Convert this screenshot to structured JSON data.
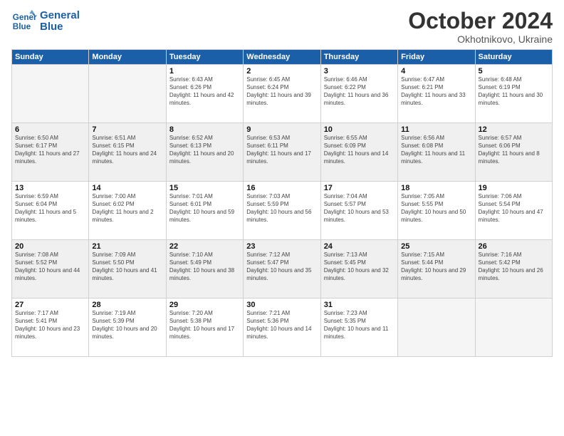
{
  "header": {
    "logo_line1": "General",
    "logo_line2": "Blue",
    "month": "October 2024",
    "location": "Okhotnikovo, Ukraine"
  },
  "weekdays": [
    "Sunday",
    "Monday",
    "Tuesday",
    "Wednesday",
    "Thursday",
    "Friday",
    "Saturday"
  ],
  "weeks": [
    [
      {
        "day": "",
        "info": ""
      },
      {
        "day": "",
        "info": ""
      },
      {
        "day": "1",
        "info": "Sunrise: 6:43 AM\nSunset: 6:26 PM\nDaylight: 11 hours and 42 minutes."
      },
      {
        "day": "2",
        "info": "Sunrise: 6:45 AM\nSunset: 6:24 PM\nDaylight: 11 hours and 39 minutes."
      },
      {
        "day": "3",
        "info": "Sunrise: 6:46 AM\nSunset: 6:22 PM\nDaylight: 11 hours and 36 minutes."
      },
      {
        "day": "4",
        "info": "Sunrise: 6:47 AM\nSunset: 6:21 PM\nDaylight: 11 hours and 33 minutes."
      },
      {
        "day": "5",
        "info": "Sunrise: 6:48 AM\nSunset: 6:19 PM\nDaylight: 11 hours and 30 minutes."
      }
    ],
    [
      {
        "day": "6",
        "info": "Sunrise: 6:50 AM\nSunset: 6:17 PM\nDaylight: 11 hours and 27 minutes."
      },
      {
        "day": "7",
        "info": "Sunrise: 6:51 AM\nSunset: 6:15 PM\nDaylight: 11 hours and 24 minutes."
      },
      {
        "day": "8",
        "info": "Sunrise: 6:52 AM\nSunset: 6:13 PM\nDaylight: 11 hours and 20 minutes."
      },
      {
        "day": "9",
        "info": "Sunrise: 6:53 AM\nSunset: 6:11 PM\nDaylight: 11 hours and 17 minutes."
      },
      {
        "day": "10",
        "info": "Sunrise: 6:55 AM\nSunset: 6:09 PM\nDaylight: 11 hours and 14 minutes."
      },
      {
        "day": "11",
        "info": "Sunrise: 6:56 AM\nSunset: 6:08 PM\nDaylight: 11 hours and 11 minutes."
      },
      {
        "day": "12",
        "info": "Sunrise: 6:57 AM\nSunset: 6:06 PM\nDaylight: 11 hours and 8 minutes."
      }
    ],
    [
      {
        "day": "13",
        "info": "Sunrise: 6:59 AM\nSunset: 6:04 PM\nDaylight: 11 hours and 5 minutes."
      },
      {
        "day": "14",
        "info": "Sunrise: 7:00 AM\nSunset: 6:02 PM\nDaylight: 11 hours and 2 minutes."
      },
      {
        "day": "15",
        "info": "Sunrise: 7:01 AM\nSunset: 6:01 PM\nDaylight: 10 hours and 59 minutes."
      },
      {
        "day": "16",
        "info": "Sunrise: 7:03 AM\nSunset: 5:59 PM\nDaylight: 10 hours and 56 minutes."
      },
      {
        "day": "17",
        "info": "Sunrise: 7:04 AM\nSunset: 5:57 PM\nDaylight: 10 hours and 53 minutes."
      },
      {
        "day": "18",
        "info": "Sunrise: 7:05 AM\nSunset: 5:55 PM\nDaylight: 10 hours and 50 minutes."
      },
      {
        "day": "19",
        "info": "Sunrise: 7:06 AM\nSunset: 5:54 PM\nDaylight: 10 hours and 47 minutes."
      }
    ],
    [
      {
        "day": "20",
        "info": "Sunrise: 7:08 AM\nSunset: 5:52 PM\nDaylight: 10 hours and 44 minutes."
      },
      {
        "day": "21",
        "info": "Sunrise: 7:09 AM\nSunset: 5:50 PM\nDaylight: 10 hours and 41 minutes."
      },
      {
        "day": "22",
        "info": "Sunrise: 7:10 AM\nSunset: 5:49 PM\nDaylight: 10 hours and 38 minutes."
      },
      {
        "day": "23",
        "info": "Sunrise: 7:12 AM\nSunset: 5:47 PM\nDaylight: 10 hours and 35 minutes."
      },
      {
        "day": "24",
        "info": "Sunrise: 7:13 AM\nSunset: 5:45 PM\nDaylight: 10 hours and 32 minutes."
      },
      {
        "day": "25",
        "info": "Sunrise: 7:15 AM\nSunset: 5:44 PM\nDaylight: 10 hours and 29 minutes."
      },
      {
        "day": "26",
        "info": "Sunrise: 7:16 AM\nSunset: 5:42 PM\nDaylight: 10 hours and 26 minutes."
      }
    ],
    [
      {
        "day": "27",
        "info": "Sunrise: 7:17 AM\nSunset: 5:41 PM\nDaylight: 10 hours and 23 minutes."
      },
      {
        "day": "28",
        "info": "Sunrise: 7:19 AM\nSunset: 5:39 PM\nDaylight: 10 hours and 20 minutes."
      },
      {
        "day": "29",
        "info": "Sunrise: 7:20 AM\nSunset: 5:38 PM\nDaylight: 10 hours and 17 minutes."
      },
      {
        "day": "30",
        "info": "Sunrise: 7:21 AM\nSunset: 5:36 PM\nDaylight: 10 hours and 14 minutes."
      },
      {
        "day": "31",
        "info": "Sunrise: 7:23 AM\nSunset: 5:35 PM\nDaylight: 10 hours and 11 minutes."
      },
      {
        "day": "",
        "info": ""
      },
      {
        "day": "",
        "info": ""
      }
    ]
  ]
}
